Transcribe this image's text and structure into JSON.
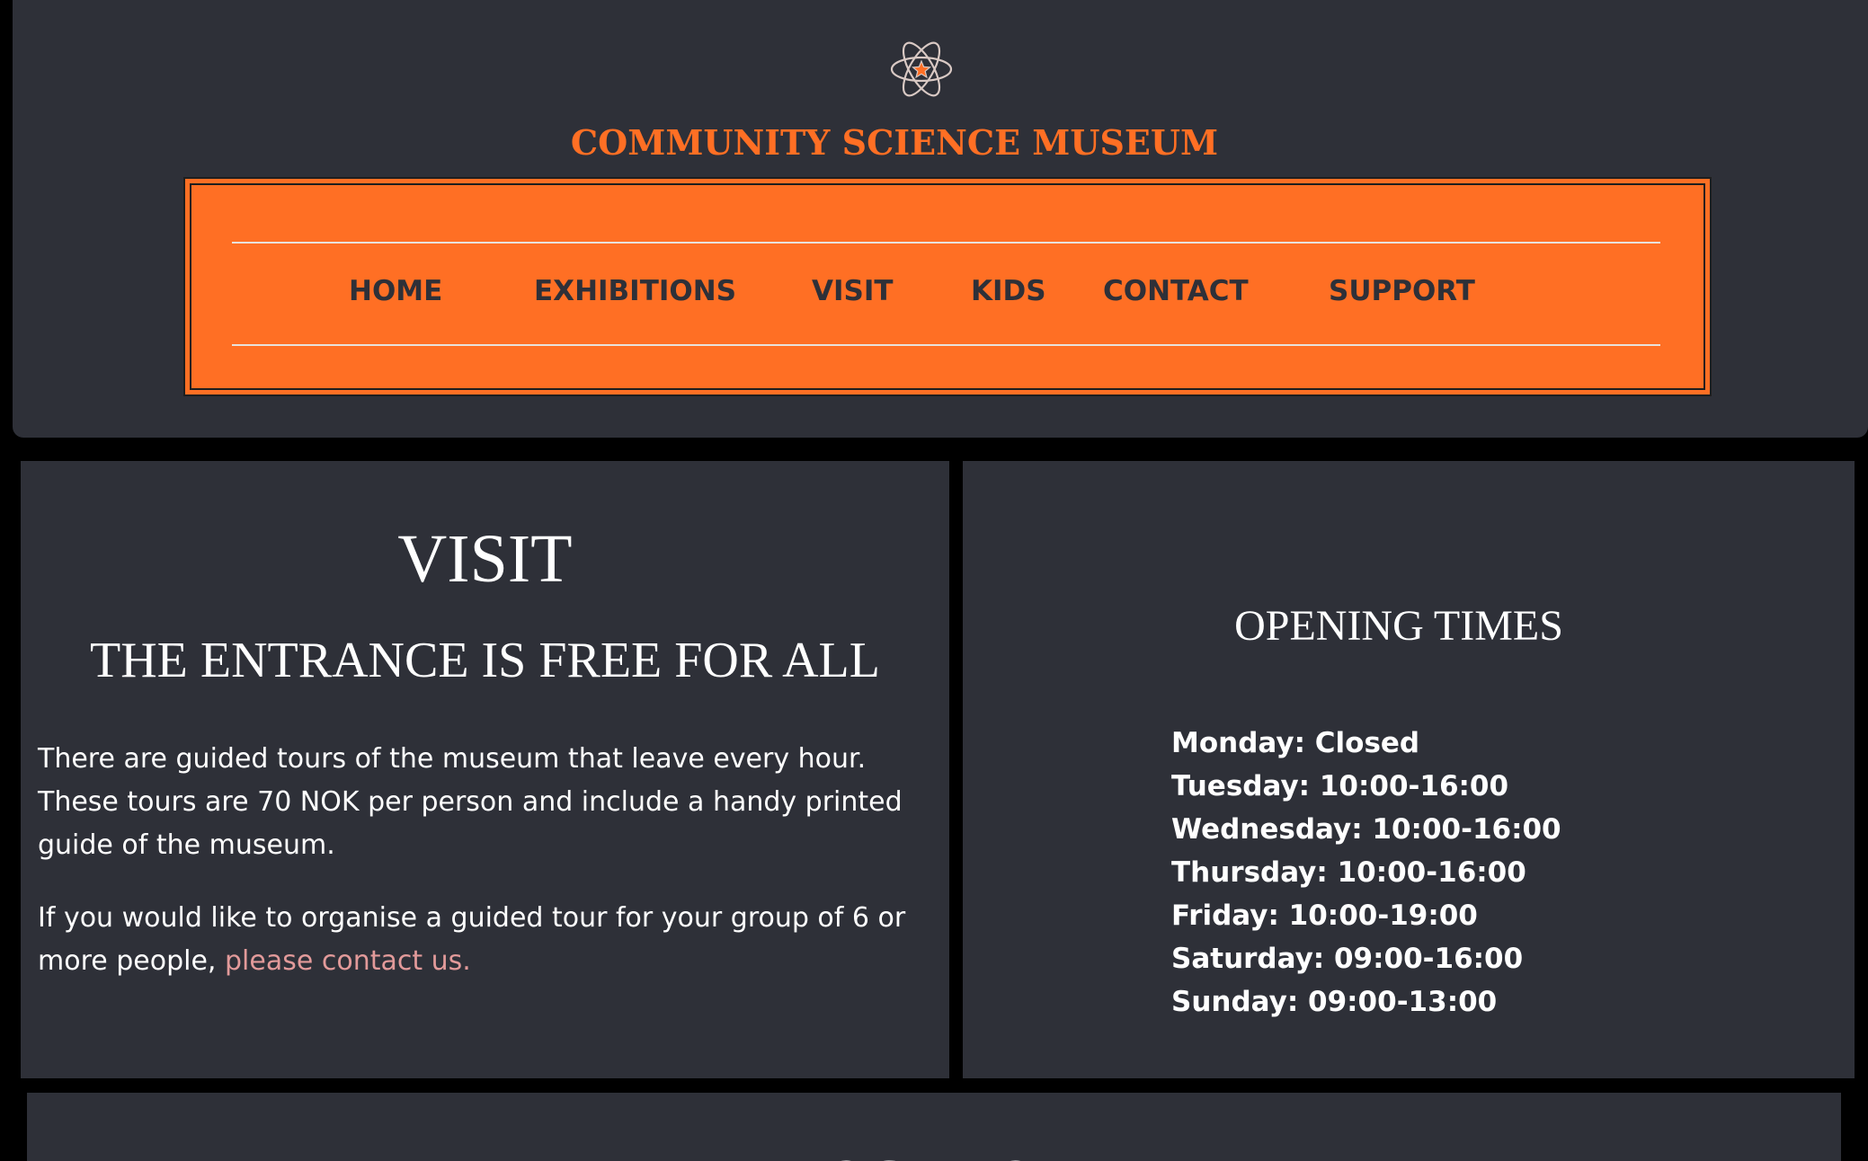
{
  "header": {
    "logo_icon": "atom-star-icon",
    "site_title": "COMMUNITY SCIENCE MUSEUM"
  },
  "nav": {
    "items": [
      {
        "label": "HOME"
      },
      {
        "label": "EXHIBITIONS"
      },
      {
        "label": "VISIT"
      },
      {
        "label": "KIDS"
      },
      {
        "label": "CONTACT"
      },
      {
        "label": "SUPPORT"
      }
    ]
  },
  "visit": {
    "heading": "VISIT",
    "subheading": "THE ENTRANCE IS FREE FOR ALL",
    "paragraph1": "There are guided tours of the museum that leave every hour. These tours are 70 NOK per person and include a handy printed guide of the museum.",
    "paragraph2_text": "If you would like to organise a guided tour for your group of 6 or more people, ",
    "paragraph2_link": "please contact us."
  },
  "opening_times": {
    "heading": "OPENING TIMES",
    "days": [
      "Monday: Closed",
      "Tuesday: 10:00-16:00",
      "Wednesday: 10:00-16:00",
      "Thursday: 10:00-16:00",
      "Friday: 10:00-19:00",
      "Saturday: 09:00-16:00",
      "Sunday: 09:00-13:00"
    ]
  },
  "location": {
    "heading": "LOCATION"
  },
  "colors": {
    "background": "#000000",
    "panel": "#2e3038",
    "accent": "#ff6f24",
    "link": "#e29a9a",
    "text": "#ffffff"
  }
}
